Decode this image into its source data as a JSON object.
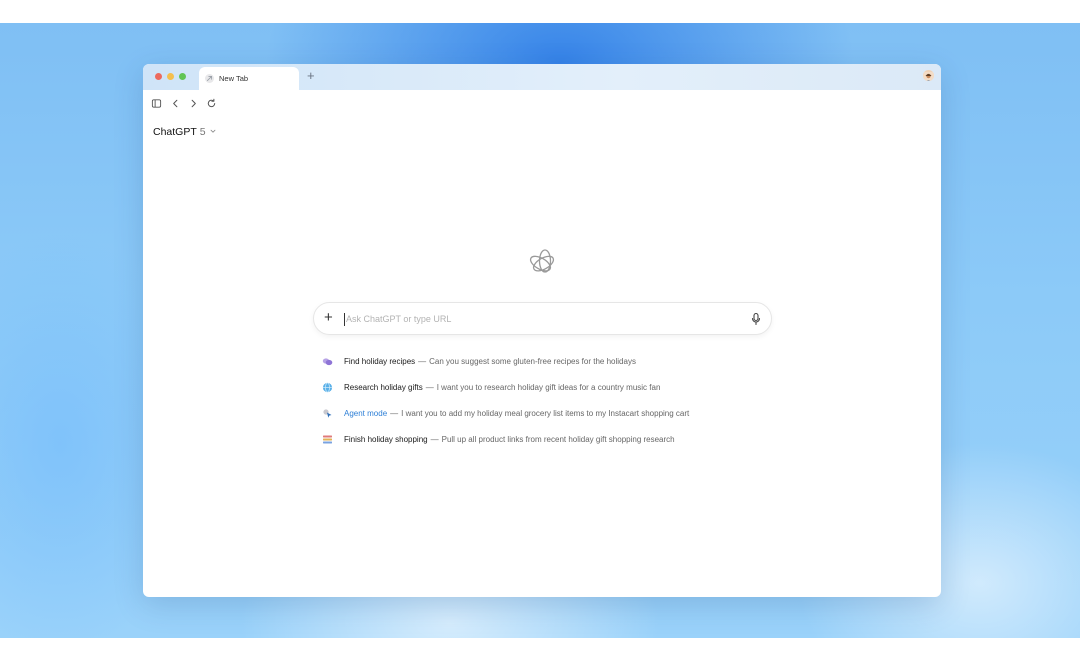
{
  "browser": {
    "tab": {
      "title": "New Tab"
    },
    "new_tab_label": "+",
    "toolbar": {
      "sidebar_icon": "sidebar-toggle-icon",
      "back_icon": "chevron-left-icon",
      "forward_icon": "chevron-right-icon",
      "reload_icon": "reload-icon"
    }
  },
  "model_switcher": {
    "name": "ChatGPT",
    "version": "5"
  },
  "omnibox": {
    "plus_label": "+",
    "placeholder": "Ask ChatGPT or type URL",
    "value": ""
  },
  "suggestions": [
    {
      "title": "Find holiday recipes",
      "separator": "—",
      "description": "Can you suggest some gluten-free recipes for the holidays",
      "icon": "recipe-icon"
    },
    {
      "title": "Research holiday gifts",
      "separator": "—",
      "description": "I want you to research holiday gift ideas for a country music fan",
      "icon": "globe-icon"
    },
    {
      "title": "Agent mode",
      "separator": "—",
      "description": "I want you to add my holiday meal grocery list items to my Instacart shopping cart",
      "icon": "agent-cursor-icon"
    },
    {
      "title": "Finish holiday shopping",
      "separator": "—",
      "description": "Pull up all product links from recent holiday gift shopping research",
      "icon": "shopping-list-icon"
    }
  ],
  "colors": {
    "accent_link": "#2d7fd6",
    "traffic_red": "#ec6a5e",
    "traffic_yellow": "#f4bf4f",
    "traffic_green": "#61c554"
  }
}
